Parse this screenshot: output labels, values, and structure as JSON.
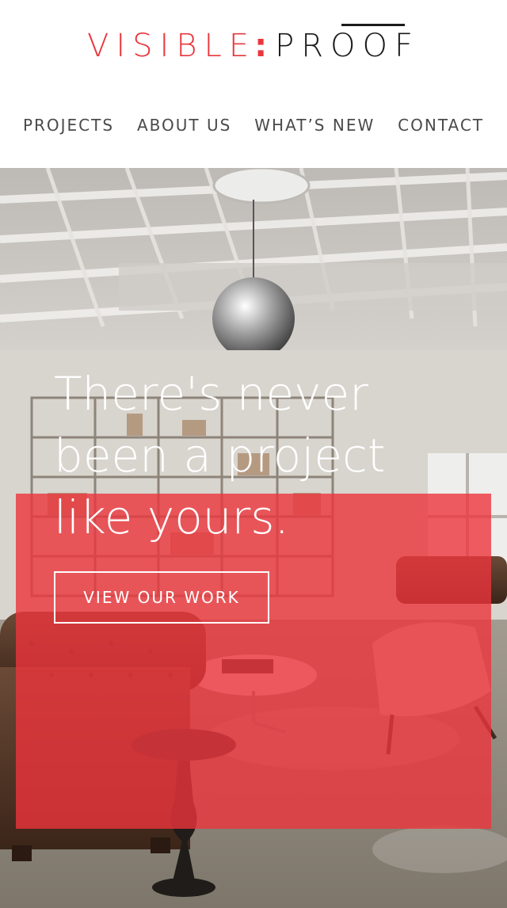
{
  "brand": {
    "name_left": "VISIBLE",
    "separator": ":",
    "name_right": "PROOF",
    "accent_color": "#e8383d",
    "dark_color": "#1b1b1b"
  },
  "nav": {
    "items": [
      {
        "label": "PROJECTS"
      },
      {
        "label": "ABOUT US"
      },
      {
        "label": "WHAT’S NEW"
      },
      {
        "label": "CONTACT"
      }
    ]
  },
  "hero": {
    "headline": "There's never been a project like yours.",
    "cta_label": "VIEW OUR WORK",
    "overlay_color": "#ec343c",
    "image_subject": "office-lounge-photo"
  }
}
